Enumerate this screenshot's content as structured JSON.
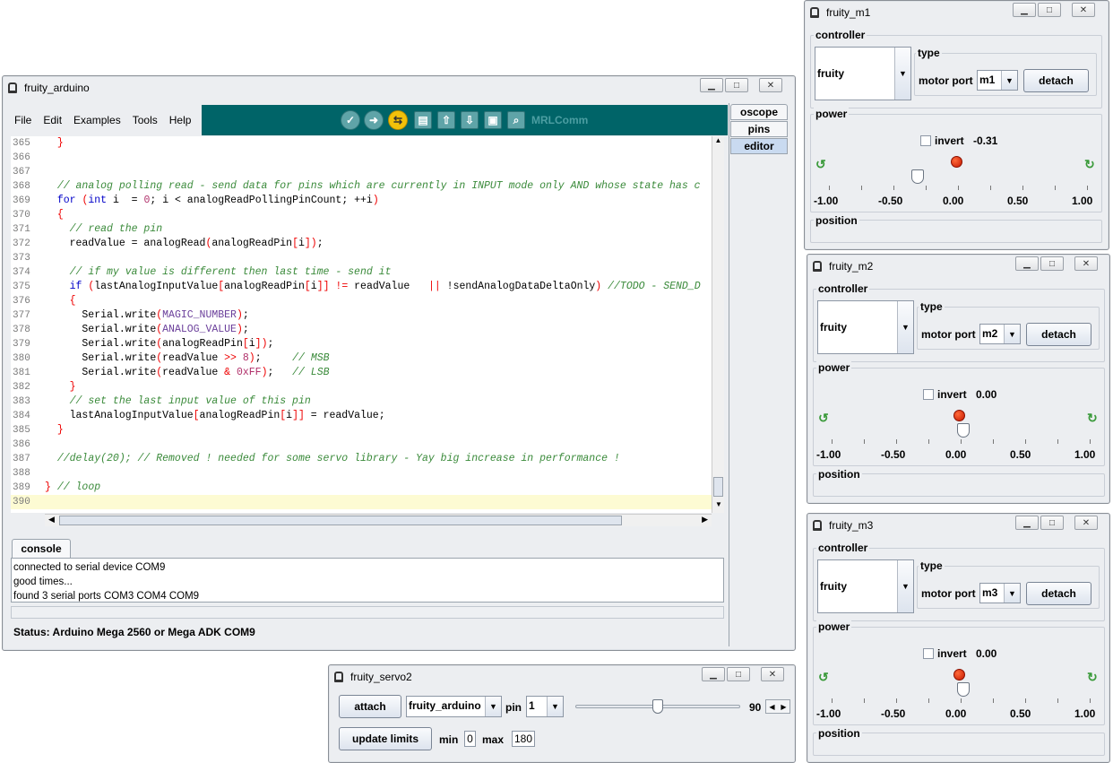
{
  "arduino": {
    "title": "fruity_arduino",
    "menu": [
      "File",
      "Edit",
      "Examples",
      "Tools",
      "Help"
    ],
    "comm_label": "MRLComm",
    "tabs": [
      "oscope",
      "pins",
      "editor"
    ],
    "lines": [
      {
        "n": "365",
        "t": "  }"
      },
      {
        "n": "366",
        "t": ""
      },
      {
        "n": "367",
        "t": ""
      },
      {
        "n": "368",
        "t": "  // analog polling read - send data for pins which are currently in INPUT mode only AND whose state has c"
      },
      {
        "n": "369",
        "t": "  for (int i  = 0; i < analogReadPollingPinCount; ++i)"
      },
      {
        "n": "370",
        "t": "  {"
      },
      {
        "n": "371",
        "t": "    // read the pin"
      },
      {
        "n": "372",
        "t": "    readValue = analogRead(analogReadPin[i]);"
      },
      {
        "n": "373",
        "t": ""
      },
      {
        "n": "374",
        "t": "    // if my value is different then last time - send it"
      },
      {
        "n": "375",
        "t": "    if (lastAnalogInputValue[analogReadPin[i]] != readValue   || !sendAnalogDataDeltaOnly) //TODO - SEND_D"
      },
      {
        "n": "376",
        "t": "    {"
      },
      {
        "n": "377",
        "t": "      Serial.write(MAGIC_NUMBER);"
      },
      {
        "n": "378",
        "t": "      Serial.write(ANALOG_VALUE);"
      },
      {
        "n": "379",
        "t": "      Serial.write(analogReadPin[i]);"
      },
      {
        "n": "380",
        "t": "      Serial.write(readValue >> 8);     // MSB"
      },
      {
        "n": "381",
        "t": "      Serial.write(readValue & 0xFF);   // LSB"
      },
      {
        "n": "382",
        "t": "    }"
      },
      {
        "n": "383",
        "t": "    // set the last input value of this pin"
      },
      {
        "n": "384",
        "t": "    lastAnalogInputValue[analogReadPin[i]] = readValue;"
      },
      {
        "n": "385",
        "t": "  }"
      },
      {
        "n": "386",
        "t": ""
      },
      {
        "n": "387",
        "t": "  //delay(20); // Removed ! needed for some servo library - Yay big increase in performance !"
      },
      {
        "n": "388",
        "t": ""
      },
      {
        "n": "389",
        "t": "} // loop"
      },
      {
        "n": "390",
        "t": ""
      }
    ],
    "console_tab": "console",
    "console_lines": [
      "connected to serial device COM9",
      "good times...",
      "found 3 serial ports COM3 COM4 COM9"
    ],
    "status": "Status: Arduino Mega 2560 or Mega ADK COM9"
  },
  "motors": [
    {
      "title": "fruity_m1",
      "controller": "fruity",
      "port": "m1",
      "power": "-0.31",
      "level": -0.31
    },
    {
      "title": "fruity_m2",
      "controller": "fruity",
      "port": "m2",
      "power": "0.00",
      "level": 0
    },
    {
      "title": "fruity_m3",
      "controller": "fruity",
      "port": "m3",
      "power": "0.00",
      "level": 0
    }
  ],
  "motor_labels": {
    "controller": "controller",
    "type": "type",
    "motor_port": "motor port",
    "detach": "detach",
    "power": "power",
    "invert": "invert",
    "position": "position",
    "scale": [
      "-1.00",
      "-0.50",
      "0.00",
      "0.50",
      "1.00"
    ]
  },
  "servo": {
    "title": "fruity_servo2",
    "attach": "attach",
    "controller": "fruity_arduino",
    "pin_label": "pin",
    "pin": "1",
    "value": "90",
    "level": 0.5,
    "update": "update limits",
    "min_label": "min",
    "min": "0",
    "max_label": "max",
    "max": "180"
  }
}
